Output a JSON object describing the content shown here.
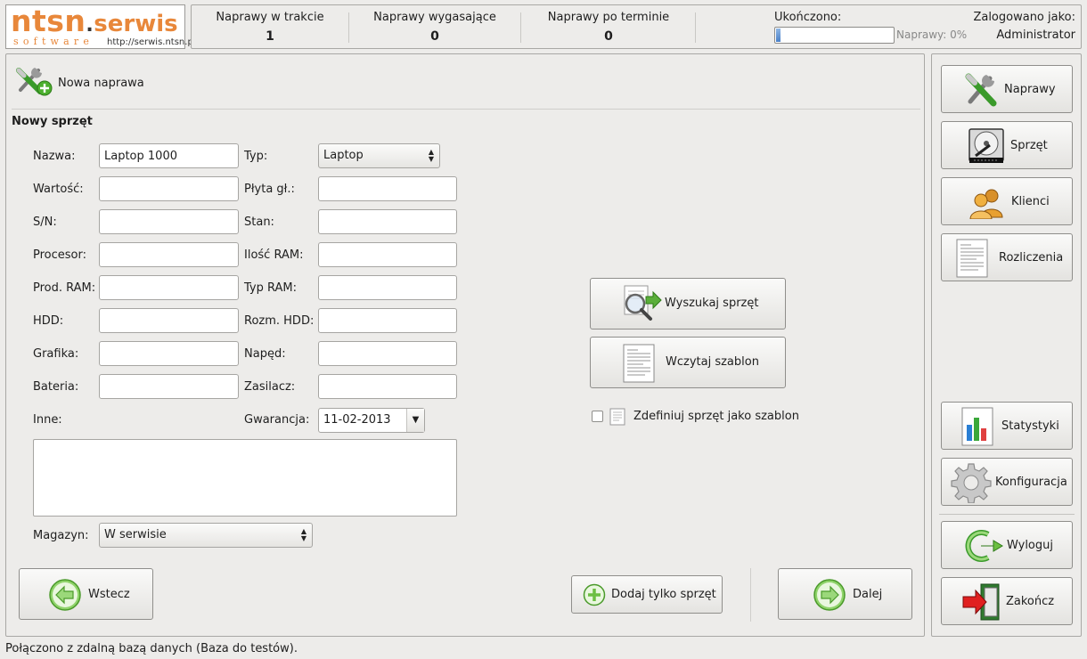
{
  "header": {
    "logo": {
      "text_main": "ntsn",
      "text_brand": "serwis",
      "text_sub": "software",
      "url": "http://serwis.ntsn.pl"
    },
    "stats": [
      {
        "label": "Naprawy w trakcie",
        "value": "1"
      },
      {
        "label": "Naprawy wygasające",
        "value": "0"
      },
      {
        "label": "Naprawy po terminie",
        "value": "0"
      }
    ],
    "completed_label": "Ukończono:",
    "progress": {
      "percent": 0,
      "text": "Naprawy: 0%"
    },
    "logged_in_label": "Zalogowano jako:",
    "logged_in_user": "Administrator"
  },
  "breadcrumb": {
    "label": "Nowa naprawa",
    "icon": "tools-add-icon"
  },
  "form": {
    "section_title": "Nowy sprzęt",
    "left_fields": [
      {
        "label": "Nazwa:",
        "value": "Laptop 1000"
      },
      {
        "label": "Wartość:",
        "value": ""
      },
      {
        "label": "S/N:",
        "value": ""
      },
      {
        "label": "Procesor:",
        "value": ""
      },
      {
        "label": "Prod. RAM:",
        "value": ""
      },
      {
        "label": "HDD:",
        "value": ""
      },
      {
        "label": "Grafika:",
        "value": ""
      },
      {
        "label": "Bateria:",
        "value": ""
      }
    ],
    "right_fields": [
      {
        "label": "Typ:",
        "value": "Laptop"
      },
      {
        "label": "Płyta gł.:",
        "value": ""
      },
      {
        "label": "Stan:",
        "value": ""
      },
      {
        "label": "Ilość RAM:",
        "value": ""
      },
      {
        "label": "Typ RAM:",
        "value": ""
      },
      {
        "label": "Rozm. HDD:",
        "value": ""
      },
      {
        "label": "Napęd:",
        "value": ""
      },
      {
        "label": "Zasilacz:",
        "value": ""
      }
    ],
    "other_label": "Inne:",
    "warranty_label": "Gwarancja:",
    "warranty_value": "11-02-2013",
    "warehouse_label": "Magazyn:",
    "warehouse_value": "W serwisie",
    "search_button": "Wyszukaj sprzęt",
    "load_template_button": "Wczytaj szablon",
    "define_template_checkbox": "Zdefiniuj sprzęt jako szablon",
    "back_button": "Wstecz",
    "add_only_button": "Dodaj tylko sprzęt",
    "next_button": "Dalej"
  },
  "sidebar": {
    "items": [
      {
        "label": "Naprawy",
        "icon": "tools-icon"
      },
      {
        "label": "Sprzęt",
        "icon": "hard-drive-icon"
      },
      {
        "label": "Klienci",
        "icon": "users-icon"
      },
      {
        "label": "Rozliczenia",
        "icon": "document-icon"
      },
      {
        "label": "Statystyki",
        "icon": "bar-chart-icon"
      },
      {
        "label": "Konfiguracja",
        "icon": "gear-icon"
      },
      {
        "label": "Wyloguj",
        "icon": "logout-icon"
      },
      {
        "label": "Zakończ",
        "icon": "exit-door-icon"
      }
    ]
  },
  "status_bar": "Połączono z zdalną bazą danych (Baza do testów)."
}
